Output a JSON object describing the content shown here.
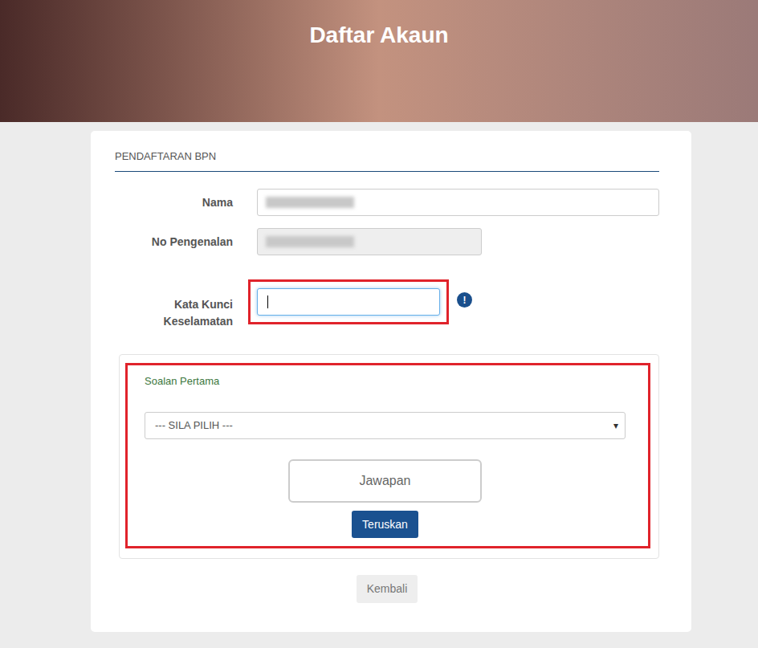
{
  "header": {
    "title": "Daftar Akaun"
  },
  "section": {
    "title": "PENDAFTARAN BPN"
  },
  "fields": [
    {
      "label": "Nama",
      "disabled": false
    },
    {
      "label": "No Pengenalan",
      "disabled": true
    }
  ],
  "password": {
    "label": "Kata Kunci Keselamatan",
    "focused": true,
    "highlighted": true,
    "info": "!"
  },
  "question": {
    "label": "Soalan Pertama",
    "highlighted": true,
    "select": {
      "placeholder": "--- SILA PILIH ---",
      "arrow": "▾"
    },
    "answer": {
      "placeholder": "Jawapan"
    },
    "button": "Teruskan"
  },
  "back_button": "Kembali"
}
